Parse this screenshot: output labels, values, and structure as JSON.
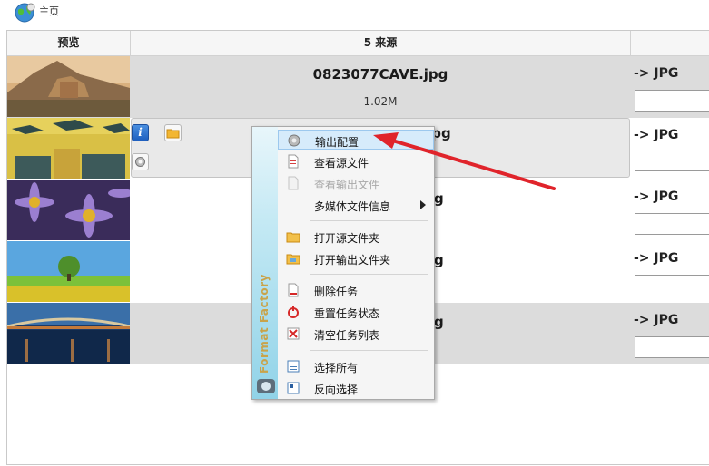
{
  "breadcrumb": {
    "home_label": "主页"
  },
  "table": {
    "col_preview": "预览",
    "col_source": "5 来源",
    "col_output": ""
  },
  "rows": [
    {
      "filename": "0823077CAVE.jpg",
      "size": "1.02M",
      "format": "-> JPG"
    },
    {
      "filename": "ph.jpg",
      "format": "-> JPG"
    },
    {
      "filename": "g",
      "format": "-> JPG"
    },
    {
      "filename": "g",
      "format": "-> JPG"
    },
    {
      "filename": "g",
      "format": "-> JPG"
    }
  ],
  "row_tools": {
    "info_label": "i"
  },
  "context_menu": {
    "brand": "Format Factory",
    "items": [
      {
        "label": "输出配置",
        "icon": "gear-icon",
        "highlighted": true
      },
      {
        "label": "查看源文件",
        "icon": "document-icon"
      },
      {
        "label": "查看输出文件",
        "icon": "document-icon",
        "disabled": true
      },
      {
        "label": "多媒体文件信息",
        "icon": "",
        "submenu": true
      },
      {
        "label": "打开源文件夹",
        "icon": "folder-icon"
      },
      {
        "label": "打开输出文件夹",
        "icon": "folder-icon"
      },
      {
        "label": "删除任务",
        "icon": "delete-document-icon"
      },
      {
        "label": "重置任务状态",
        "icon": "reset-icon"
      },
      {
        "label": "清空任务列表",
        "icon": "clear-list-icon"
      },
      {
        "label": "选择所有",
        "icon": "select-all-icon"
      },
      {
        "label": "反向选择",
        "icon": "invert-selection-icon"
      }
    ]
  },
  "colors": {
    "annotation_arrow": "#e0242b",
    "row_gray": "#dcdcdc",
    "menu_highlight": "#d6ebfb"
  }
}
